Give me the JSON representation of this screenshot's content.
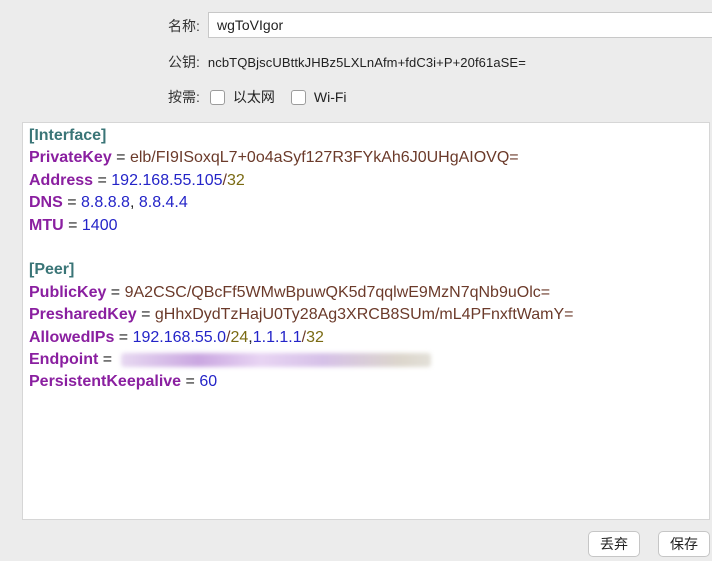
{
  "form": {
    "name_label": "名称:",
    "name_value": "wgToVIgor",
    "public_key_label": "公钥:",
    "public_key_value": "ncbTQBjscUBttkJHBz5LXLnAfm+fdC3i+P+20f61aSE=",
    "on_demand_label": "按需:",
    "ethernet_label": "以太网",
    "wifi_label": "Wi-Fi",
    "ethernet_checked": false,
    "wifi_checked": false
  },
  "config": {
    "interface_header": "[Interface]",
    "private_key_key": "PrivateKey",
    "private_key_value": "elb/FI9ISoxqL7+0o4aSyf127R3FYkAh6J0UHgAIOVQ=",
    "address_key": "Address",
    "address_ip": "192.168.55.105",
    "address_mask": "32",
    "dns_key": "DNS",
    "dns_1": "8.8.8.8",
    "dns_2": "8.8.4.4",
    "mtu_key": "MTU",
    "mtu_value": "1400",
    "peer_header": "[Peer]",
    "public_key_key": "PublicKey",
    "public_key_value": "9A2CSC/QBcFf5WMwBpuwQK5d7qqlwE9MzN7qNb9uOlc=",
    "preshared_key_key": "PresharedKey",
    "preshared_key_value": "gHhxDydTzHajU0Ty28Ag3XRCB8SUm/mL4PFnxftWamY=",
    "allowed_ips_key": "AllowedIPs",
    "allowed_1_ip": "192.168.55.0",
    "allowed_1_mask": "24",
    "allowed_2_ip": "1.1.1.1",
    "allowed_2_mask": "32",
    "endpoint_key": "Endpoint",
    "keepalive_key": "PersistentKeepalive",
    "keepalive_value": "60"
  },
  "buttons": {
    "discard": "丢弃",
    "save": "保存"
  },
  "colors": {
    "section": "#3a7577",
    "key": "#8a1fa0",
    "number": "#2424c8",
    "string": "#6b3a2a"
  }
}
